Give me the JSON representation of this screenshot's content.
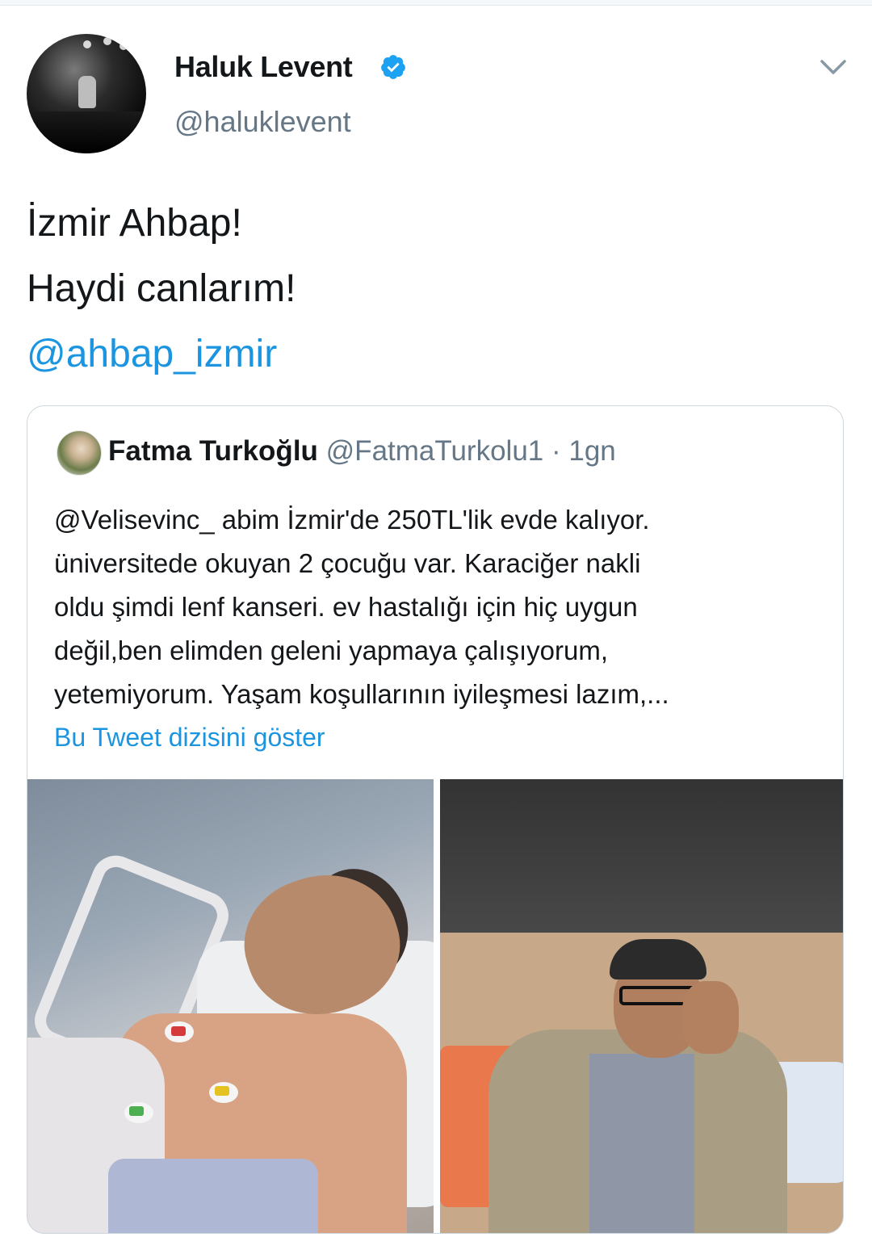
{
  "author": {
    "display_name": "Haluk Levent",
    "handle": "@haluklevent",
    "verified": true
  },
  "tweet": {
    "lines": [
      "İzmir Ahbap!",
      "Haydi canlarım!"
    ],
    "mention": "@ahbap_izmir"
  },
  "quoted_tweet": {
    "display_name": "Fatma Turkoğlu",
    "handle": "@FatmaTurkolu1",
    "separator": "·",
    "time": "1gn",
    "text_lines": [
      "@Velisevinc_ abim İzmir'de 250TL'lik evde kalıyor.",
      "üniversitede okuyan 2 çocuğu var. Karaciğer nakli",
      "oldu şimdi lenf kanseri. ev hastalığı için hiç uygun",
      "değil,ben elimden geleni yapmaya çalışıyorum,",
      "yetemiyorum. Yaşam koşullarının iyileşmesi lazım,..."
    ],
    "show_thread_label": "Bu Tweet dizisini göster"
  },
  "colors": {
    "link_blue": "#1b95e0",
    "muted_gray": "#657786",
    "verified_blue": "#1da1f2",
    "border": "#ccd6dd"
  }
}
